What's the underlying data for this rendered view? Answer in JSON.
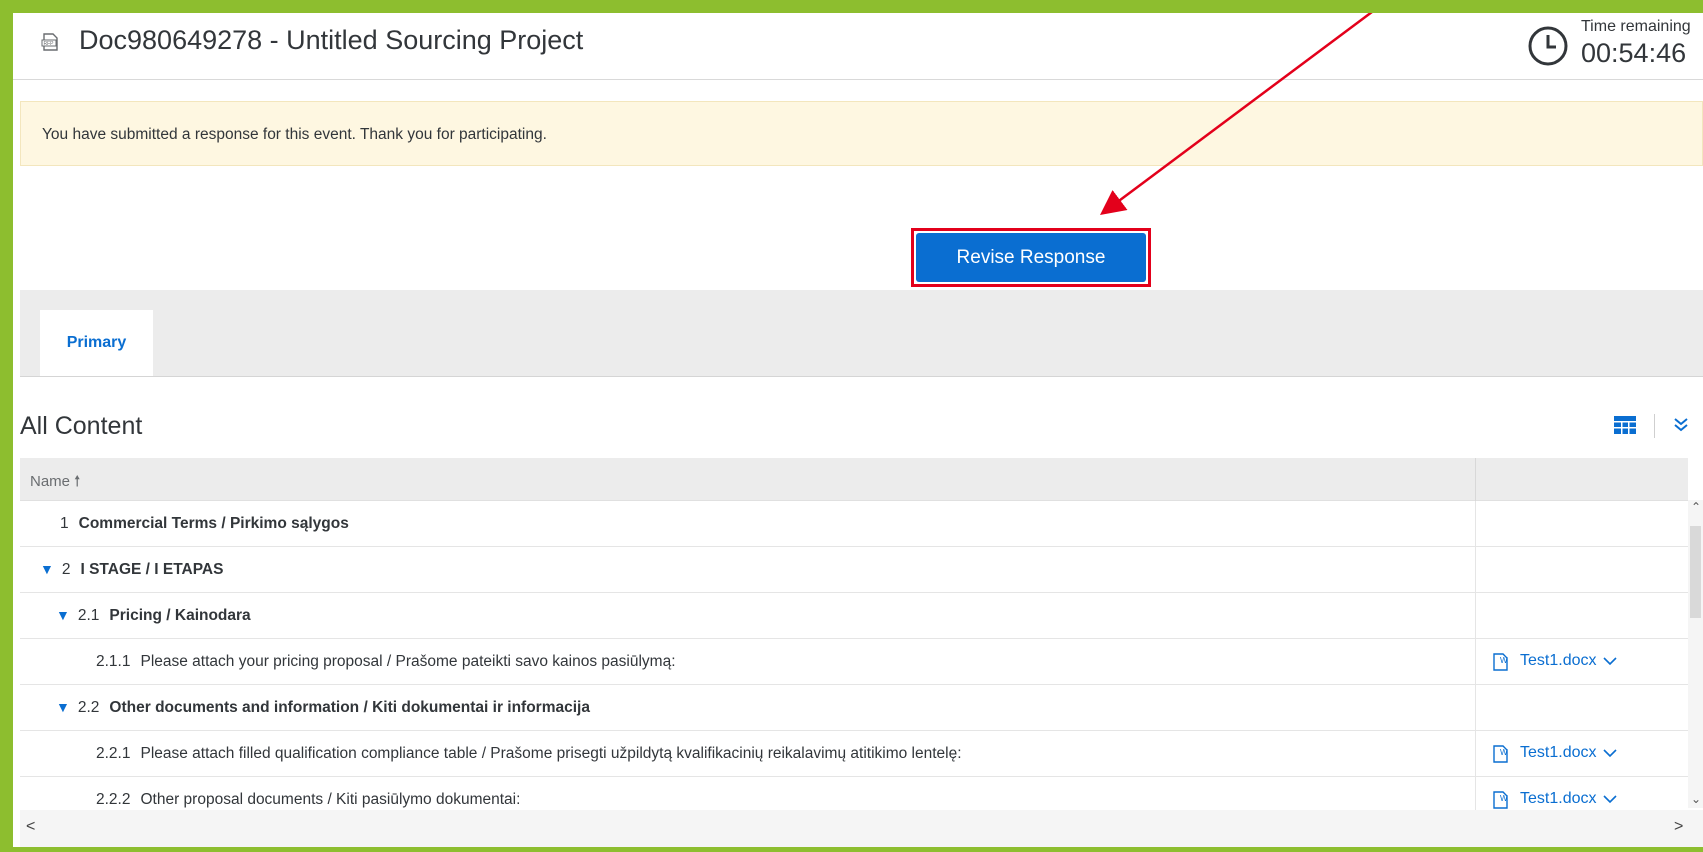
{
  "header": {
    "doc_icon_label": "RFP",
    "title": "Doc980649278 - Untitled Sourcing Project",
    "time_remaining_label": "Time remaining",
    "time_remaining_value": "00:54:46"
  },
  "banner": {
    "message": "You have submitted a response for this event.  Thank you for participating."
  },
  "actions": {
    "revise_label": "Revise Response"
  },
  "tabs": [
    {
      "label": "Primary",
      "active": true
    }
  ],
  "content": {
    "title": "All Content",
    "column_name": "Name",
    "sort_icon": "arrow-up",
    "rows": [
      {
        "num": "1",
        "label": "Commercial Terms / Pirkimo sąlygos",
        "bold": true,
        "expanded": null,
        "attachment": ""
      },
      {
        "num": "2",
        "label": "I STAGE / I ETAPAS",
        "bold": true,
        "expanded": true,
        "attachment": ""
      },
      {
        "num": "2.1",
        "label": "Pricing / Kainodara",
        "bold": true,
        "expanded": true,
        "attachment": ""
      },
      {
        "num": "2.1.1",
        "label": "Please attach your pricing proposal / Prašome pateikti savo kainos pasiūlymą:",
        "bold": false,
        "expanded": null,
        "attachment": "Test1.docx"
      },
      {
        "num": "2.2",
        "label": "Other documents and information / Kiti dokumentai ir informacija",
        "bold": true,
        "expanded": true,
        "attachment": ""
      },
      {
        "num": "2.2.1",
        "label": "Please attach filled qualification compliance table / Prašome prisegti užpildytą kvalifikacinių reikalavimų atitikimo lentelę:",
        "bold": false,
        "expanded": null,
        "attachment": "Test1.docx"
      },
      {
        "num": "2.2.2",
        "label": "Other proposal documents / Kiti pasiūlymo dokumentai:",
        "bold": false,
        "expanded": null,
        "attachment": "Test1.docx"
      }
    ]
  },
  "colors": {
    "frame": "#8dbe2f",
    "accent": "#0a6ed1",
    "highlight": "#e3001b",
    "banner_bg": "#fef7e1"
  }
}
